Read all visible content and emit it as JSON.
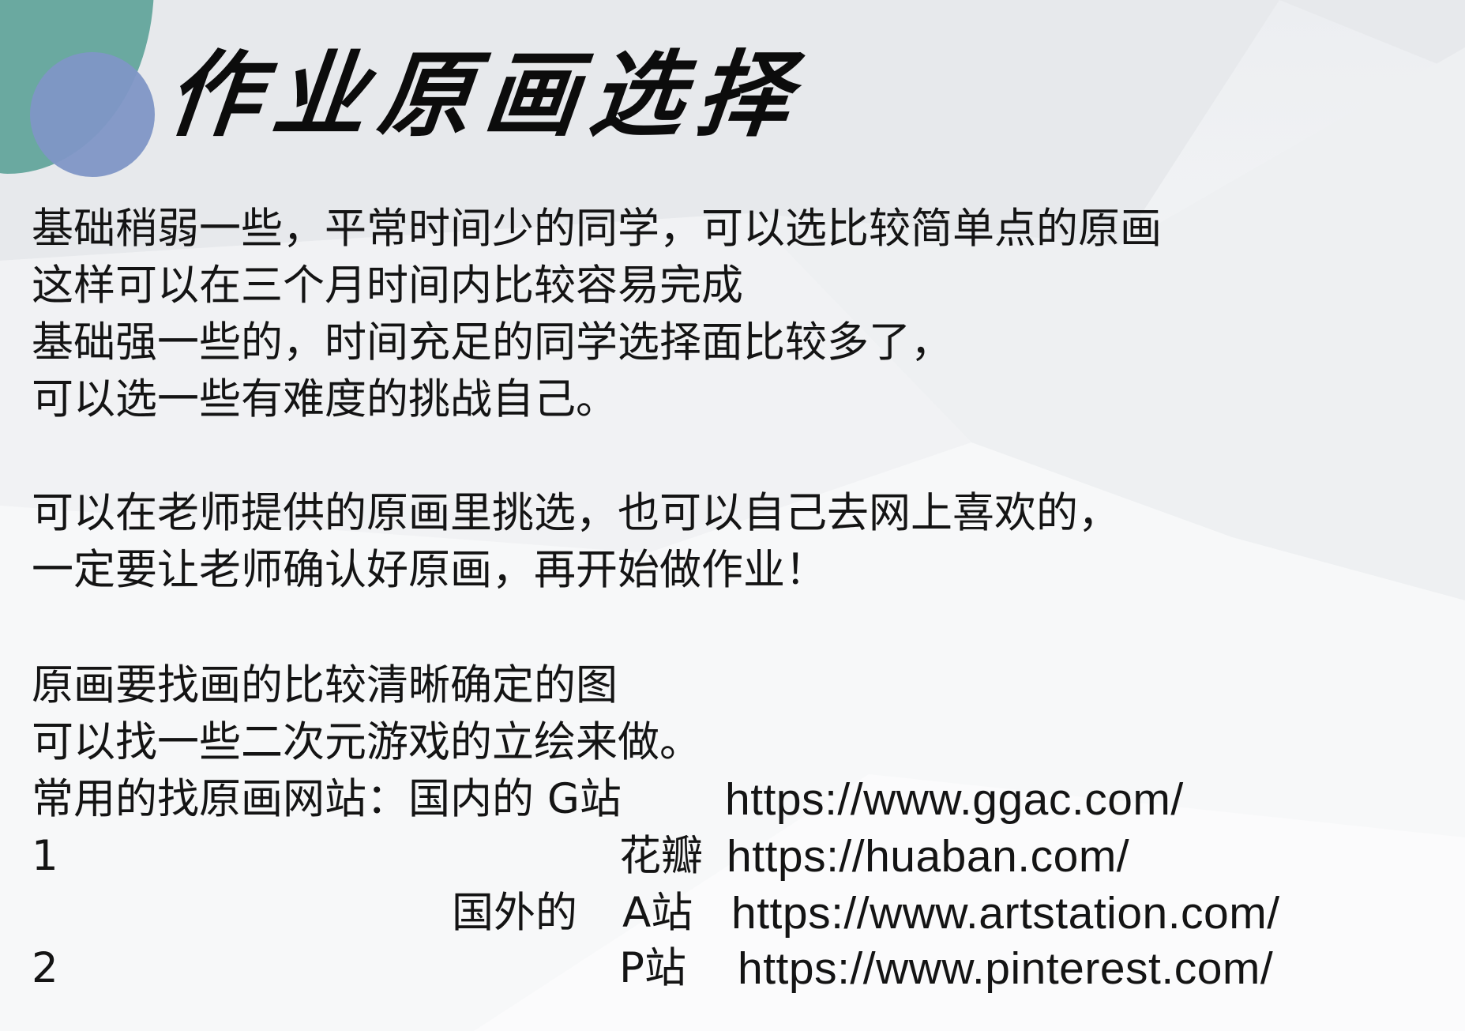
{
  "title": "作业原画选择",
  "paragraph1": [
    "基础稍弱一些，平常时间少的同学，可以选比较简单点的原画",
    "这样可以在三个月时间内比较容易完成",
    "基础强一些的，时间充足的同学选择面比较多了，",
    "可以选一些有难度的挑战自己。"
  ],
  "paragraph2": [
    "可以在老师提供的原画里挑选，也可以自己去网上喜欢的，",
    "一定要让老师确认好原画，再开始做作业！"
  ],
  "paragraph3": [
    "原画要找画的比较清晰确定的图",
    "可以找一些二次元游戏的立绘来做。"
  ],
  "sites": {
    "intro": "常用的找原画网站：国内的 G站",
    "ggac_url": "https://www.ggac.com/",
    "row1_number": "1",
    "huaban_label": "花瓣",
    "huaban_url": "https://huaban.com/",
    "foreign_label": "国外的",
    "artstation_label": "A站",
    "artstation_url": "https://www.artstation.com/",
    "row2_number": "2",
    "pinterest_label": "P站",
    "pinterest_url": "https://www.pinterest.com/"
  },
  "colors": {
    "teal_decoration": "#6aa9a0",
    "blue_decoration": "#7f96c6",
    "text": "#141414"
  }
}
